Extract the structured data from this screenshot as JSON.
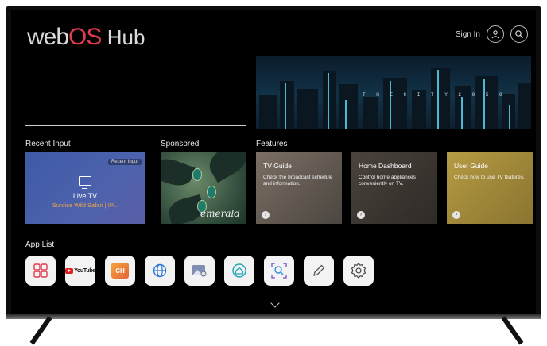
{
  "header": {
    "logo_web": "web",
    "logo_os": "OS",
    "logo_hub": "Hub",
    "sign_in": "Sign In"
  },
  "hero": {
    "caption": "T H E  C I T Y  2 0 5 0"
  },
  "sections": {
    "recent_input": "Recent Input",
    "sponsored": "Sponsored",
    "features": "Features",
    "app_list": "App List"
  },
  "recent_card": {
    "tag": "Recent Input",
    "name": "Live TV",
    "subtitle": "Sunrise Wild Safari | IP..."
  },
  "sponsored_card": {
    "brand": "emerald"
  },
  "features": [
    {
      "title": "TV Guide",
      "desc": "Check the broadcast schedule and information."
    },
    {
      "title": "Home Dashboard",
      "desc": "Control home appliances conveniently on TV."
    },
    {
      "title": "User Guide",
      "desc": "Check how to use TV features."
    }
  ],
  "apps": [
    {
      "name": "apps-grid-icon"
    },
    {
      "name": "youtube-icon",
      "label": "YouTube"
    },
    {
      "name": "lg-channels-icon",
      "label": "CH"
    },
    {
      "name": "web-browser-icon"
    },
    {
      "name": "gallery-icon"
    },
    {
      "name": "home-dashboard-icon"
    },
    {
      "name": "search-app-icon"
    },
    {
      "name": "edit-icon"
    },
    {
      "name": "settings-icon"
    }
  ],
  "colors": {
    "logo_accent": "#e03a4f",
    "recent_card": "#4a5fae",
    "subtitle": "#f0a24a",
    "youtube_red": "#e02020"
  }
}
